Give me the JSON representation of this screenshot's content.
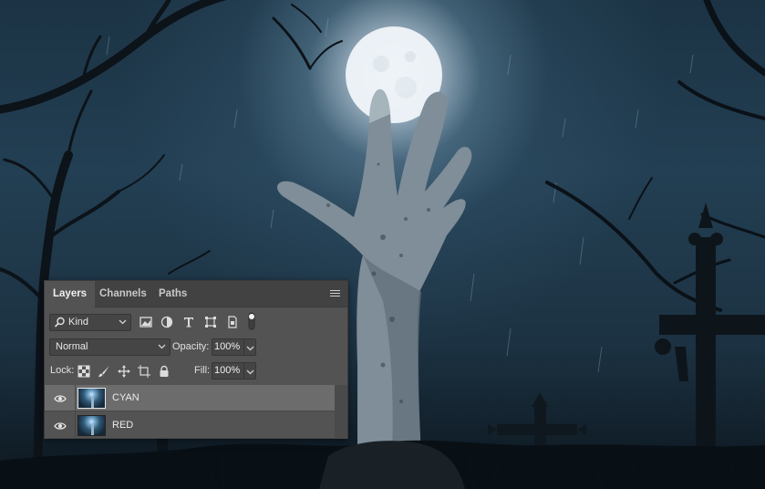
{
  "panel": {
    "tabs": [
      {
        "label": "Layers",
        "active": true
      },
      {
        "label": "Channels",
        "active": false
      },
      {
        "label": "Paths",
        "active": false
      }
    ],
    "filter": {
      "kind_label": "Kind",
      "icons": [
        "image-filter-icon",
        "adjustment-filter-icon",
        "type-filter-icon",
        "shape-filter-icon",
        "smart-object-filter-icon",
        "filter-toggle-icon"
      ]
    },
    "blend": {
      "mode": "Normal",
      "opacity_label": "Opacity:",
      "opacity_value": "100%"
    },
    "lock": {
      "label": "Lock:",
      "icons": [
        "lock-transparent-icon",
        "lock-image-icon",
        "lock-position-icon",
        "lock-artboard-icon",
        "lock-all-icon"
      ],
      "fill_label": "Fill:",
      "fill_value": "100%"
    },
    "layers": [
      {
        "name": "CYAN",
        "visible": true,
        "selected": true
      },
      {
        "name": "RED",
        "visible": true,
        "selected": false
      }
    ]
  },
  "colors": {
    "panel_bg": "#535353",
    "tab_bar_bg": "#424242",
    "selected_row_bg": "#6c6c6c",
    "sky_dark": "#1b3344",
    "moon_glow": "#ebf5ff"
  }
}
